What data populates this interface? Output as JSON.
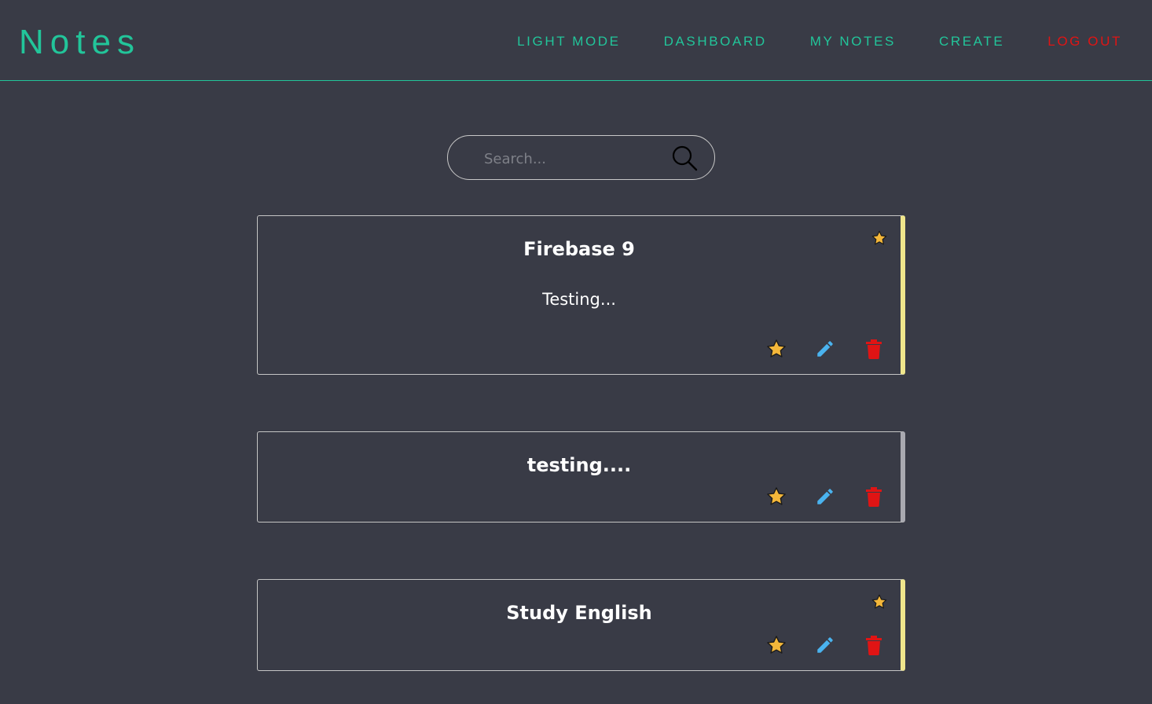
{
  "navbar": {
    "brand": "Notes",
    "links": {
      "light_mode": "LIGHT MODE",
      "dashboard": "DASHBOARD",
      "my_notes": "MY NOTES",
      "create": "CREATE",
      "log_out": "LOG OUT"
    }
  },
  "search": {
    "placeholder": "Search...",
    "value": ""
  },
  "notes": [
    {
      "title": "Firebase 9",
      "body": "Testing...",
      "favorite": true
    },
    {
      "title": "testing....",
      "body": "",
      "favorite": false
    },
    {
      "title": "Study English",
      "body": "",
      "favorite": true
    }
  ],
  "colors": {
    "background": "#393b46",
    "accent": "#22c59a",
    "logout": "#e01414",
    "favorite_border": "#f0e68c",
    "plain_border": "#a9a9b0",
    "star": "#f4b73a",
    "edit": "#4ab3ef",
    "delete": "#e01414"
  },
  "icons": {
    "search": "magnifier-icon",
    "favorite": "star-icon",
    "edit": "pencil-icon",
    "delete": "trash-icon"
  }
}
